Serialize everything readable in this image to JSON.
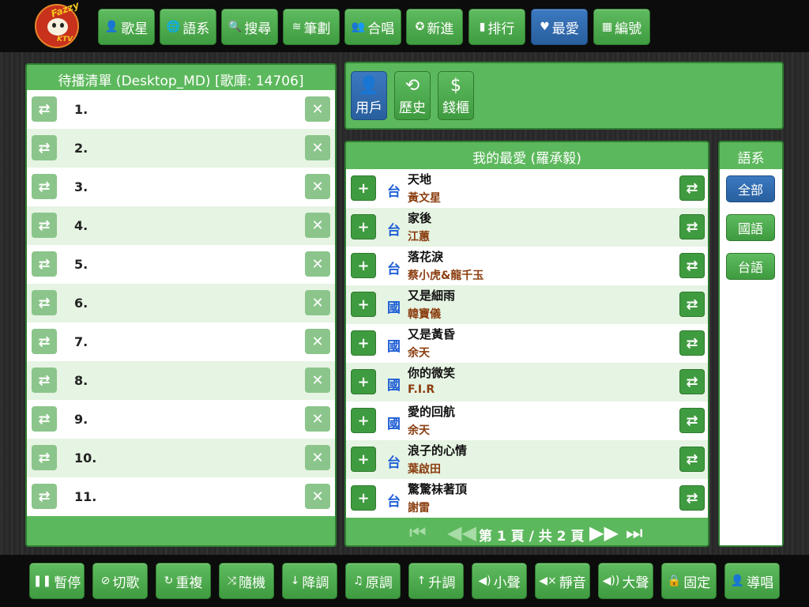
{
  "logo": {
    "line1": "Fazzy",
    "line2": "KTV"
  },
  "top_nav": [
    {
      "label": "歌星",
      "icon": "person-icon"
    },
    {
      "label": "語系",
      "icon": "globe-icon"
    },
    {
      "label": "搜尋",
      "icon": "search-icon"
    },
    {
      "label": "筆劃",
      "icon": "strokes-icon"
    },
    {
      "label": "合唱",
      "icon": "duet-icon"
    },
    {
      "label": "新進",
      "icon": "new-icon"
    },
    {
      "label": "排行",
      "icon": "bar-chart-icon"
    },
    {
      "label": "最愛",
      "icon": "heart-icon"
    },
    {
      "label": "編號",
      "icon": "calculator-icon"
    }
  ],
  "queue": {
    "title": "待播清單 (Desktop_MD) [歌庫: 14706]",
    "items": [
      "1.",
      "2.",
      "3.",
      "4.",
      "5.",
      "6.",
      "7.",
      "8.",
      "9.",
      "10.",
      "11."
    ]
  },
  "user_tabs": [
    {
      "label": "用戶",
      "icon": "user-icon"
    },
    {
      "label": "歷史",
      "icon": "history-icon"
    },
    {
      "label": "錢櫃",
      "icon": "money-bag-icon"
    }
  ],
  "favorites": {
    "title": "我的最愛 (羅承毅)",
    "songs": [
      {
        "lang": "台",
        "title": "天地",
        "artist": "黃文星"
      },
      {
        "lang": "台",
        "title": "家後",
        "artist": "江蕙"
      },
      {
        "lang": "台",
        "title": "落花淚",
        "artist": "蔡小虎&龍千玉"
      },
      {
        "lang": "國",
        "title": "又是細雨",
        "artist": "韓寶儀"
      },
      {
        "lang": "國",
        "title": "又是黃昏",
        "artist": "余天"
      },
      {
        "lang": "國",
        "title": "你的微笑",
        "artist": "F.I.R"
      },
      {
        "lang": "國",
        "title": "愛的回航",
        "artist": "余天"
      },
      {
        "lang": "台",
        "title": "浪子的心情",
        "artist": "葉啟田"
      },
      {
        "lang": "台",
        "title": "驚驚袜著頂",
        "artist": "謝雷"
      }
    ],
    "pagination": "第 1 頁 / 共 2 頁"
  },
  "language_filter": {
    "title": "語系",
    "options": [
      "全部",
      "國語",
      "台語"
    ]
  },
  "bottom_controls": [
    {
      "label": "暫停",
      "icon": "pause-icon",
      "glyph": "❚❚"
    },
    {
      "label": "切歌",
      "icon": "skip-icon",
      "glyph": "⊘"
    },
    {
      "label": "重複",
      "icon": "repeat-icon",
      "glyph": "↻"
    },
    {
      "label": "隨機",
      "icon": "shuffle-icon",
      "glyph": "⤨"
    },
    {
      "label": "降調",
      "icon": "arrow-down-icon",
      "glyph": "↓"
    },
    {
      "label": "原調",
      "icon": "music-note-icon",
      "glyph": "♫"
    },
    {
      "label": "升調",
      "icon": "arrow-up-icon",
      "glyph": "↑"
    },
    {
      "label": "小聲",
      "icon": "volume-low-icon",
      "glyph": "◀)"
    },
    {
      "label": "靜音",
      "icon": "mute-icon",
      "glyph": "◀×"
    },
    {
      "label": "大聲",
      "icon": "volume-high-icon",
      "glyph": "◀))"
    },
    {
      "label": "固定",
      "icon": "lock-icon",
      "glyph": "🔒"
    },
    {
      "label": "導唱",
      "icon": "singer-icon",
      "glyph": "👤"
    }
  ],
  "colors": {
    "accent_green": "#5cb85c",
    "active_blue": "#337ab7",
    "lang_blue": "#1f5fd6",
    "artist_brown": "#8b3e10"
  }
}
